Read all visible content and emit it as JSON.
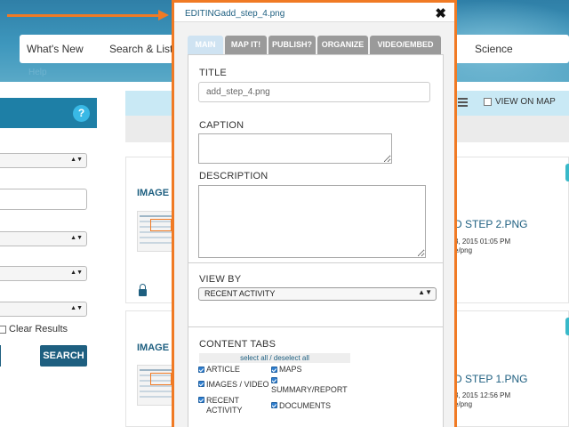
{
  "nav": {
    "items": [
      "What's New",
      "Search & List V",
      "Science"
    ],
    "help": "Help"
  },
  "left_panel": {
    "help_icon": "?",
    "clear_results_label": "Clear Results",
    "search_button": "SEARCH"
  },
  "toolbar": {
    "view_on_map_label": "VIEW ON MAP",
    "list_view_icon": "list-icon"
  },
  "results": [
    {
      "type": "IMAGE",
      "title": "D STEP 2.PNG",
      "date": "3, 2015 01:05 PM",
      "mime": "e/png",
      "locked": true
    },
    {
      "type": "IMAGE",
      "title": "D STEP 1.PNG",
      "date": "3, 2015 12:56 PM",
      "mime": "e/png",
      "locked": false
    }
  ],
  "modal": {
    "title": "EDITINGadd_step_4.png",
    "close_label": "✖",
    "tabs": [
      {
        "label": "MAIN",
        "active": true
      },
      {
        "label": "MAP IT!",
        "active": false
      },
      {
        "label": "PUBLISH?",
        "active": false
      },
      {
        "label": "ORGANIZE",
        "active": false
      },
      {
        "label": "VIDEO/EMBED",
        "active": false
      }
    ],
    "title_label": "TITLE",
    "title_value": "add_step_4.png",
    "caption_label": "CAPTION",
    "caption_value": "",
    "description_label": "DESCRIPTION",
    "description_value": "",
    "view_by_label": "VIEW BY",
    "view_by_value": "RECENT ACTIVITY",
    "content_tabs_label": "CONTENT TABS",
    "select_all_label": "select all / deselect all",
    "content_tabs": [
      {
        "label": "ARTICLE",
        "checked": true
      },
      {
        "label": "MAPS",
        "checked": true
      },
      {
        "label": "IMAGES / VIDEO",
        "checked": true
      },
      {
        "label": "SUMMARY/REPORT",
        "checked": true
      },
      {
        "label": "RECENT ACTIVITY",
        "checked": true
      },
      {
        "label": "DOCUMENTS",
        "checked": true
      }
    ]
  },
  "colors": {
    "accent_orange": "#f07a24",
    "brand_blue": "#1e5f80",
    "tab_gray": "#9a9a9a",
    "tab_active": "#cfe3f2",
    "toolbar_blue": "#c9e9f5"
  }
}
